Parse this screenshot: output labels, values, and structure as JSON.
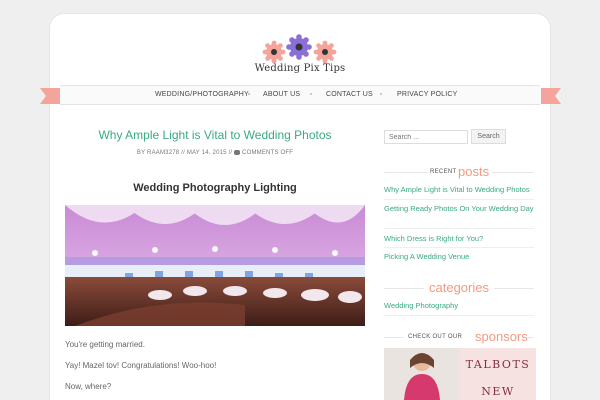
{
  "site": {
    "logo_text": "Wedding Pix Tips"
  },
  "nav": {
    "items": [
      "WEDDING/PHOTOGRAPHY",
      "ABOUT US",
      "CONTACT US",
      "PRIVACY POLICY"
    ]
  },
  "post": {
    "title": "Why Ample Light is Vital to Wedding Photos",
    "meta_by": "BY RAAM3278",
    "meta_date": "MAY 14, 2015",
    "meta_comments": "COMMENTS OFF",
    "sep": "//",
    "heading": "Wedding Photography Lighting",
    "paragraphs": [
      "You're getting married.",
      "Yay! Mazel tov! Congratulations! Woo-hoo!",
      "Now, where?"
    ]
  },
  "sidebar": {
    "search_placeholder": "Search ...",
    "search_button": "Search",
    "recent_small": "RECENT",
    "recent_big": "posts",
    "recent_posts": [
      "Why Ample Light is Vital to Wedding Photos",
      "Getting Ready Photos On Your Wedding Day",
      "Which Dress is Right for You?",
      "Picking A Wedding Venue"
    ],
    "categories_big": "categories",
    "categories": [
      "Wedding Photography"
    ],
    "sponsors_small": "CHECK OUT OUR",
    "sponsors_big": "sponsors",
    "sponsor_ad_text": [
      "TALBOTS",
      "NEW"
    ]
  },
  "colors": {
    "accent_green": "#3aa985",
    "accent_pink": "#f29a82",
    "ribbon": "#f4a49a"
  }
}
